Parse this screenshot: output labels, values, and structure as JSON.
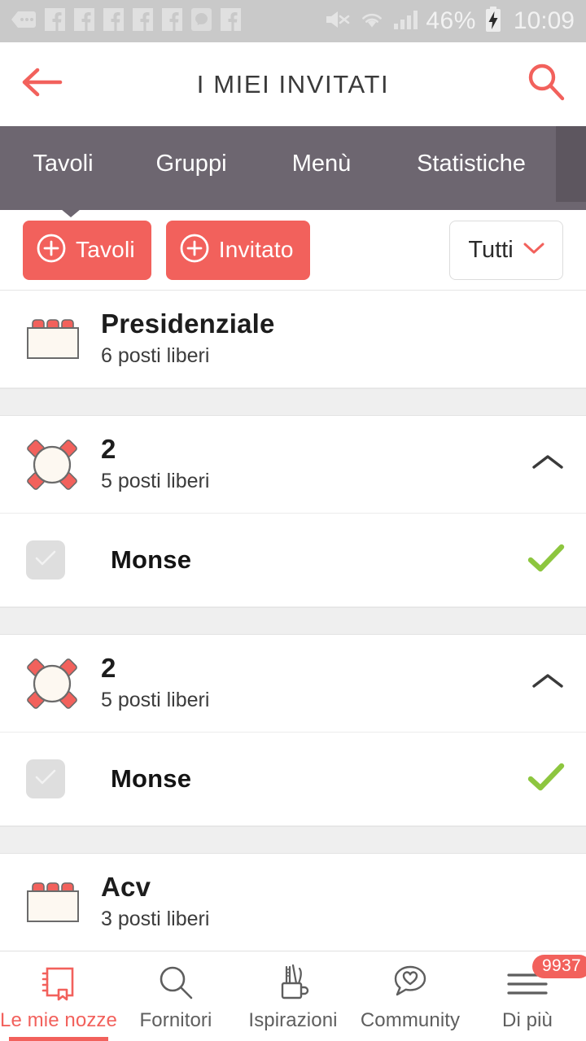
{
  "statusbar": {
    "icons": [
      "message-dots-icon",
      "facebook-icon",
      "facebook-icon",
      "facebook-icon",
      "facebook-icon",
      "facebook-icon",
      "messenger-icon",
      "facebook-icon"
    ],
    "mute_icon": "mute-icon",
    "wifi_icon": "wifi-icon",
    "signal_icon": "signal-bars-icon",
    "battery_percent": "46%",
    "battery_icon": "battery-charging-icon",
    "time": "10:09",
    "background": "#c9c9c9"
  },
  "header": {
    "back_icon": "back-arrow-icon",
    "title": "I MIEI INVITATI",
    "search_icon": "search-icon",
    "accent": "#f2615c"
  },
  "tabs": {
    "background": "#6d6670",
    "active_index": 0,
    "items": [
      {
        "label": "Tavoli"
      },
      {
        "label": "Gruppi"
      },
      {
        "label": "Menù"
      },
      {
        "label": "Statistiche"
      }
    ]
  },
  "actions": {
    "add_table": {
      "label": "Tavoli",
      "icon": "plus-circle-icon"
    },
    "add_guest": {
      "label": "Invitato",
      "icon": "plus-circle-icon"
    },
    "filter": {
      "value": "Tutti",
      "icon": "chevron-down-icon"
    }
  },
  "list": [
    {
      "kind": "table",
      "icon": "rectangular-table-icon",
      "name": "Presidenziale",
      "seats": "6 posti liberi",
      "chevron": null
    },
    {
      "kind": "band"
    },
    {
      "kind": "table",
      "icon": "round-table-icon",
      "name": "2",
      "seats": "5 posti liberi",
      "chevron": "chevron-up-icon"
    },
    {
      "kind": "guest",
      "checkbox_icon": "checkbox-icon",
      "name": "Monse",
      "status_icon": "green-check-icon"
    },
    {
      "kind": "band"
    },
    {
      "kind": "table",
      "icon": "round-table-icon",
      "name": "2",
      "seats": "5 posti liberi",
      "chevron": "chevron-up-icon"
    },
    {
      "kind": "guest",
      "checkbox_icon": "checkbox-icon",
      "name": "Monse",
      "status_icon": "green-check-icon"
    },
    {
      "kind": "band"
    },
    {
      "kind": "table",
      "icon": "rectangular-table-icon",
      "name": "Acv",
      "seats": "3 posti liberi",
      "chevron": null
    },
    {
      "kind": "band"
    }
  ],
  "bottomnav": {
    "active_index": 0,
    "items": [
      {
        "label": "Le mie nozze",
        "icon": "notebook-icon",
        "badge": null
      },
      {
        "label": "Fornitori",
        "icon": "search-icon",
        "badge": null
      },
      {
        "label": "Ispirazioni",
        "icon": "pencil-cup-icon",
        "badge": null
      },
      {
        "label": "Community",
        "icon": "speech-heart-icon",
        "badge": null
      },
      {
        "label": "Di più",
        "icon": "hamburger-menu-icon",
        "badge": "9937"
      }
    ]
  }
}
